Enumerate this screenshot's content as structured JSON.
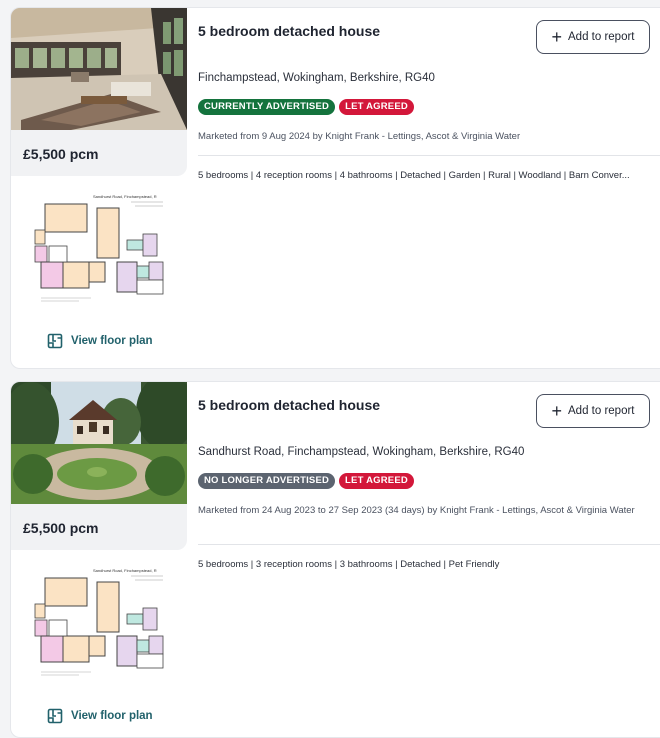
{
  "listings": [
    {
      "photo": "house-interior-living-room-photo",
      "price": "£5,500 pcm",
      "title": "5 bedroom detached house",
      "add_button": "Add to report",
      "address": "Finchampstead, Wokingham, Berkshire, RG40",
      "badges": [
        {
          "label": "CURRENTLY ADVERTISED",
          "color": "#14733d"
        },
        {
          "label": "LET AGREED",
          "color": "#d3173a"
        }
      ],
      "marketed": "Marketed from 9 Aug 2024 by Knight Frank - Lettings, Ascot & Virginia Water",
      "features": "5 bedrooms | 4 reception rooms | 4 bathrooms | Detached | Garden | Rural | Woodland | Barn Conver...",
      "floor_plan_link": "View floor plan",
      "floor_plan_heading": "Sandhurst Road, Finchampstead, R"
    },
    {
      "photo": "house-exterior-garden-photo",
      "price": "£5,500 pcm",
      "title": "5 bedroom detached house",
      "add_button": "Add to report",
      "address": "Sandhurst Road, Finchampstead, Wokingham, Berkshire, RG40",
      "badges": [
        {
          "label": "NO LONGER ADVERTISED",
          "color": "#5c6470"
        },
        {
          "label": "LET AGREED",
          "color": "#d3173a"
        }
      ],
      "marketed": "Marketed from 24 Aug 2023 to 27 Sep 2023 (34 days) by Knight Frank - Lettings, Ascot & Virginia Water",
      "features": "5 bedrooms | 3 reception rooms | 3 bathrooms | Detached | Pet Friendly",
      "floor_plan_link": "View floor plan",
      "floor_plan_heading": "Sandhurst Road, Finchampstead, R"
    }
  ],
  "icons": {
    "add": "plus-icon",
    "floor_plan": "floor-plan-icon"
  }
}
